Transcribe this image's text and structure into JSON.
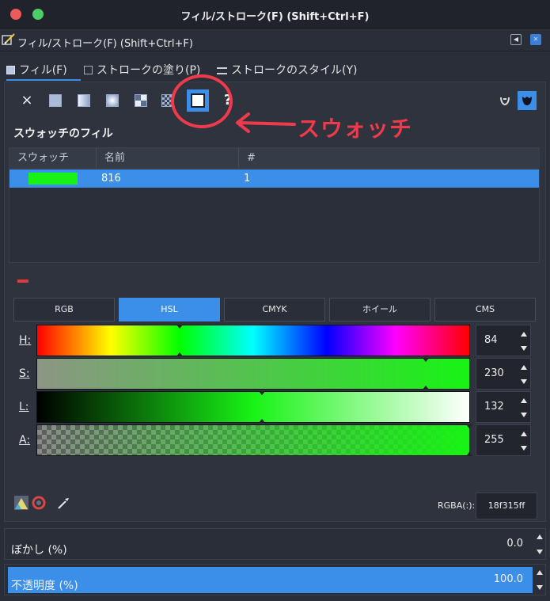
{
  "window": {
    "title": "フィル/ストローク(F) (Shift+Ctrl+F)"
  },
  "dock": {
    "title": "フィル/ストローク(F) (Shift+Ctrl+F)"
  },
  "tabs": [
    {
      "label": "フィル(F)",
      "active": true
    },
    {
      "label": "ストロークの塗り(P)",
      "active": false
    },
    {
      "label": "ストロークのスタイル(Y)",
      "active": false
    }
  ],
  "fill_types": {
    "none_glyph": "×",
    "unknown_glyph": "?",
    "selected": "swatch"
  },
  "annotation": {
    "text": "スウォッチ",
    "color": "#ef3a4c"
  },
  "section": {
    "title": "スウォッチのフィル"
  },
  "swatch_table": {
    "columns": [
      "スウォッチ",
      "名前",
      "#"
    ],
    "rows": [
      {
        "color": "#18f315",
        "name": "816",
        "count": "1"
      }
    ]
  },
  "color_modes": [
    "RGB",
    "HSL",
    "CMYK",
    "ホイール",
    "CMS"
  ],
  "active_mode": "HSL",
  "sliders": [
    {
      "label": "H:",
      "value": "84",
      "fraction": 0.33
    },
    {
      "label": "S:",
      "value": "230",
      "fraction": 0.9
    },
    {
      "label": "L:",
      "value": "132",
      "fraction": 0.52
    },
    {
      "label": "A:",
      "value": "255",
      "fraction": 1.0
    }
  ],
  "rgba": {
    "label": "RGBA(:):",
    "value": "18f315ff"
  },
  "blur": {
    "label": "ぼかし (%)",
    "value": "0.0"
  },
  "opacity": {
    "label": "不透明度 (%)",
    "value": "100.0",
    "fraction": 1.0
  },
  "colors": {
    "accent": "#3b8fe9",
    "current": "#18f315"
  }
}
